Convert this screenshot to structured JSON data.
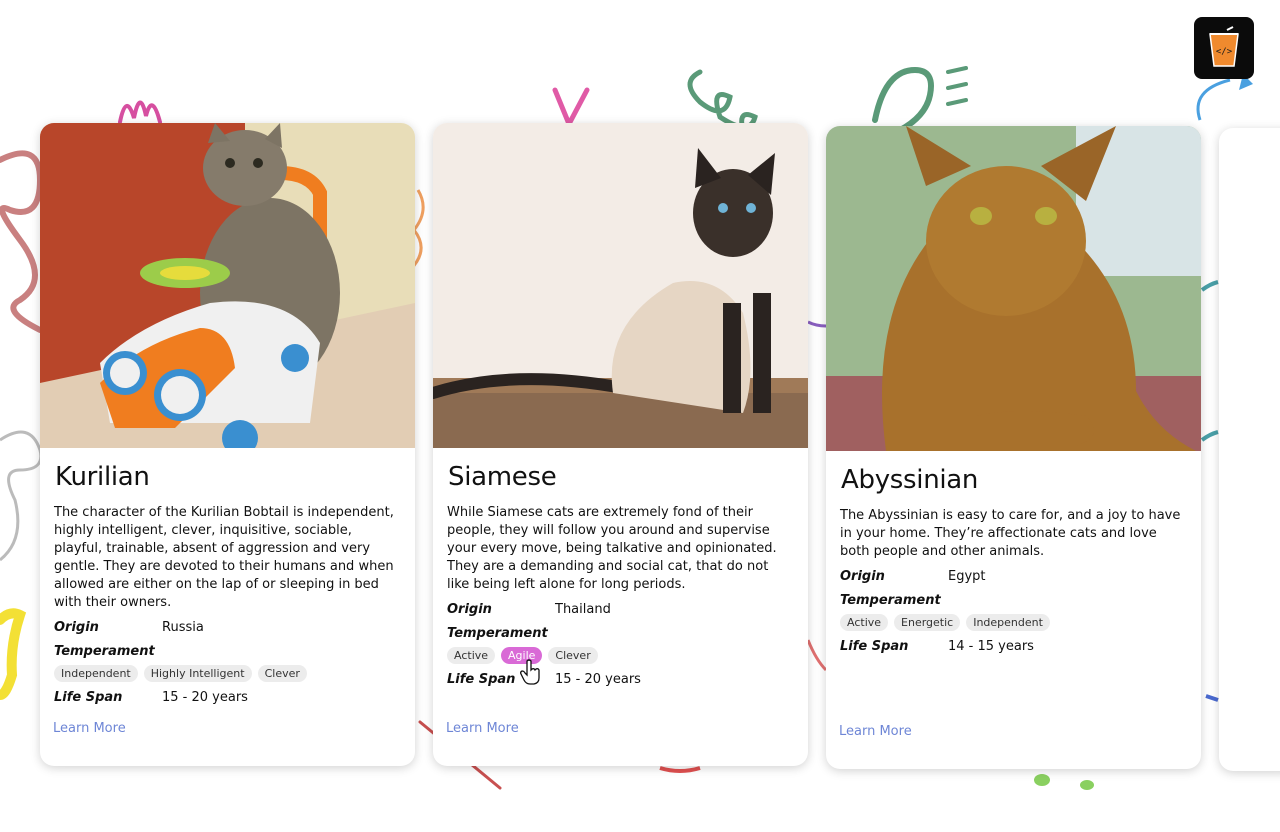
{
  "colors": {
    "accent_tag": "#d96ad6",
    "link": "#6e86d6",
    "logo_bg": "#0b0b0b",
    "logo_cup": "#f08a2e"
  },
  "logo": {
    "icon": "code-cup-icon",
    "text": "</>"
  },
  "cards": [
    {
      "name": "Kurilian",
      "image_icon": "cat-photo",
      "description": "The character of the Kurilian Bobtail is independent, highly intelligent, clever, inquisitive, sociable, playful, trainable, absent of aggression and very gentle. They are devoted to their humans and when allowed are either on the lap of or sleeping in bed with their owners.",
      "origin_label": "Origin",
      "origin": "Russia",
      "temperament_label": "Temperament",
      "temperament": [
        "Independent",
        "Highly Intelligent",
        "Clever"
      ],
      "lifespan_label": "Life Span",
      "lifespan": "15 - 20 years",
      "learn_more": "Learn More"
    },
    {
      "name": "Siamese",
      "image_icon": "cat-photo",
      "description": "While Siamese cats are extremely fond of their people, they will follow you around and supervise your every move, being talkative and opinionated. They are a demanding and social cat, that do not like being left alone for long periods.",
      "origin_label": "Origin",
      "origin": "Thailand",
      "temperament_label": "Temperament",
      "temperament": [
        "Active",
        "Agile",
        "Clever"
      ],
      "lifespan_label": "Life Span",
      "lifespan": "15 - 20 years",
      "learn_more": "Learn More"
    },
    {
      "name": "Abyssinian",
      "image_icon": "cat-photo",
      "description": "The Abyssinian is easy to care for, and a joy to have in your home. They’re affectionate cats and love both people and other animals.",
      "origin_label": "Origin",
      "origin": "Egypt",
      "temperament_label": "Temperament",
      "temperament": [
        "Active",
        "Energetic",
        "Independent"
      ],
      "lifespan_label": "Life Span",
      "lifespan": "14 - 15 years",
      "learn_more": "Learn More"
    }
  ]
}
